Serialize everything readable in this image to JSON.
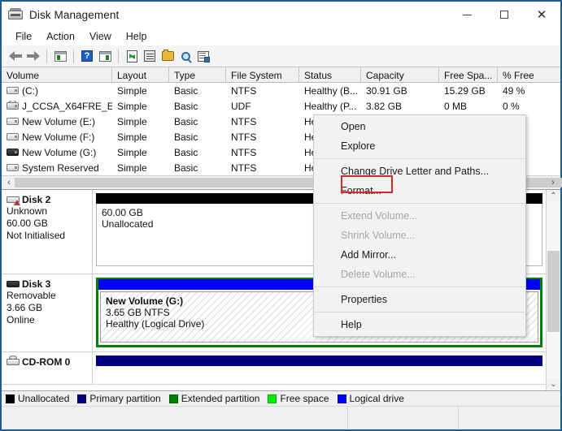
{
  "window": {
    "title": "Disk Management",
    "icon": "disk-drive-icon",
    "controls": {
      "minimize": "—",
      "maximize": "□",
      "close": "✕"
    }
  },
  "menubar": {
    "items": [
      "File",
      "Action",
      "View",
      "Help"
    ]
  },
  "toolbar": {
    "icons": [
      "back-arrow-icon",
      "forward-arrow-icon",
      "show-hide-console-tree-icon",
      "help-icon",
      "show-hide-action-pane-icon",
      "refresh-icon",
      "properties-icon",
      "open-folder-icon",
      "search-icon",
      "settings-icon"
    ]
  },
  "volume_table": {
    "columns": [
      "Volume",
      "Layout",
      "Type",
      "File System",
      "Status",
      "Capacity",
      "Free Spa...",
      "% Free"
    ],
    "rows": [
      {
        "icon": "drive-icon",
        "volume": "(C:)",
        "layout": "Simple",
        "type": "Basic",
        "filesystem": "NTFS",
        "status": "Healthy (B...",
        "capacity": "30.91 GB",
        "free_space": "15.29 GB",
        "percent_free": "49 %"
      },
      {
        "icon": "cd-drive-icon",
        "volume": "J_CCSA_X64FRE_E...",
        "layout": "Simple",
        "type": "Basic",
        "filesystem": "UDF",
        "status": "Healthy (P...",
        "capacity": "3.82 GB",
        "free_space": "0 MB",
        "percent_free": "0 %"
      },
      {
        "icon": "drive-icon",
        "volume": "New Volume (E:)",
        "layout": "Simple",
        "type": "Basic",
        "filesystem": "NTFS",
        "status": "He",
        "capacity": "",
        "free_space": "",
        "percent_free": ""
      },
      {
        "icon": "drive-icon",
        "volume": "New Volume (F:)",
        "layout": "Simple",
        "type": "Basic",
        "filesystem": "NTFS",
        "status": "He",
        "capacity": "",
        "free_space": "",
        "percent_free": ""
      },
      {
        "icon": "removable-drive-icon",
        "volume": "New Volume (G:)",
        "layout": "Simple",
        "type": "Basic",
        "filesystem": "NTFS",
        "status": "He",
        "capacity": "",
        "free_space": "",
        "percent_free": ""
      },
      {
        "icon": "drive-icon",
        "volume": "System Reserved",
        "layout": "Simple",
        "type": "Basic",
        "filesystem": "NTFS",
        "status": "He",
        "capacity": "",
        "free_space": "",
        "percent_free": ""
      }
    ]
  },
  "context_menu": {
    "items": [
      {
        "label": "Open",
        "disabled": false
      },
      {
        "label": "Explore",
        "disabled": false
      },
      {
        "separator": true
      },
      {
        "label": "Change Drive Letter and Paths...",
        "disabled": false
      },
      {
        "label": "Format...",
        "disabled": false,
        "highlighted": true
      },
      {
        "separator": true
      },
      {
        "label": "Extend Volume...",
        "disabled": true
      },
      {
        "label": "Shrink Volume...",
        "disabled": true
      },
      {
        "label": "Add Mirror...",
        "disabled": false
      },
      {
        "label": "Delete Volume...",
        "disabled": true
      },
      {
        "separator": true
      },
      {
        "label": "Properties",
        "disabled": false
      },
      {
        "separator": true
      },
      {
        "label": "Help",
        "disabled": false
      }
    ],
    "highlight_color": "#cf2b2b"
  },
  "disks": [
    {
      "name": "Disk 2",
      "icon": "disk-warning-icon",
      "type": "Unknown",
      "size": "60.00 GB",
      "state": "Not Initialised",
      "partition": {
        "kind": "unallocated",
        "bar_color": "#000000",
        "line1": "60.00 GB",
        "line2": "Unallocated",
        "line3": ""
      }
    },
    {
      "name": "Disk 3",
      "icon": "removable-disk-icon",
      "type": "Removable",
      "size": "3.66 GB",
      "state": "Online",
      "partition": {
        "kind": "logical",
        "bar_color": "#0000ff",
        "border_color": "#008000",
        "line1": "New Volume  (G:)",
        "line2": "3.65 GB NTFS",
        "line3": "Healthy (Logical Drive)"
      }
    },
    {
      "name": "CD-ROM 0",
      "icon": "cd-rom-icon",
      "type": "",
      "size": "",
      "state": "",
      "partition": {
        "kind": "primary",
        "bar_color": "#000080",
        "line1": "",
        "line2": "",
        "line3": ""
      }
    }
  ],
  "legend": [
    {
      "label": "Unallocated",
      "color": "#000000"
    },
    {
      "label": "Primary partition",
      "color": "#000080"
    },
    {
      "label": "Extended partition",
      "color": "#008000"
    },
    {
      "label": "Free space",
      "color": "#00ee00"
    },
    {
      "label": "Logical drive",
      "color": "#0000ff"
    }
  ],
  "scrollbars": {
    "horizontal_left": "‹",
    "horizontal_right": "›",
    "vertical_up": "⌃",
    "vertical_down": "⌄"
  }
}
